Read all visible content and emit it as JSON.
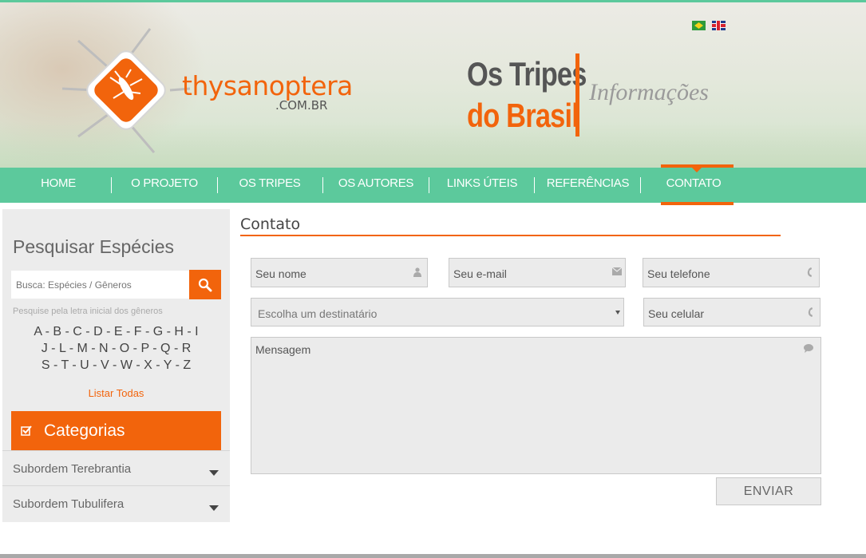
{
  "header": {
    "logo_text": "thysanoptera",
    "logo_sub": ".COM.BR",
    "title_line1": "Os Tripes",
    "title_line2": "do Brasil",
    "section": "Informações",
    "flags": [
      "brazil-flag-icon",
      "uk-flag-icon"
    ]
  },
  "nav": {
    "items": [
      {
        "label": "HOME"
      },
      {
        "label": "O PROJETO"
      },
      {
        "label": "OS TRIPES"
      },
      {
        "label": "OS AUTORES"
      },
      {
        "label": "LINKS ÚTEIS"
      },
      {
        "label": "REFERÊNCIAS"
      },
      {
        "label": "CONTATO"
      }
    ],
    "active": "CONTATO"
  },
  "sidebar": {
    "title": "Pesquisar Espécies",
    "search_placeholder": "Busca: Espécies / Gêneros",
    "hint": "Pesquise pela letra inicial dos gêneros",
    "letters_row1": "A - B - C - D - E - F - G - H - I",
    "letters_row2": "J - L - M - N - O - P - Q - R",
    "letters_row3": "S - T - U - V - W - X - Y - Z",
    "list_all": "Listar Todas",
    "categories_label": "Categorias",
    "suborders": [
      {
        "label": "Subordem Terebrantia"
      },
      {
        "label": "Subordem Tubulifera"
      }
    ]
  },
  "content": {
    "title": "Contato",
    "fields": {
      "name": "Seu nome",
      "email": "Seu e-mail",
      "phone": "Seu telefone",
      "recipient": "Escolha um destinatário",
      "mobile": "Seu celular",
      "message": "Mensagem"
    },
    "send_label": "ENVIAR"
  },
  "colors": {
    "accent": "#f2640c",
    "nav": "#5cc99c",
    "sidebar_bg": "#ececec",
    "field_bg": "#ebebeb"
  }
}
